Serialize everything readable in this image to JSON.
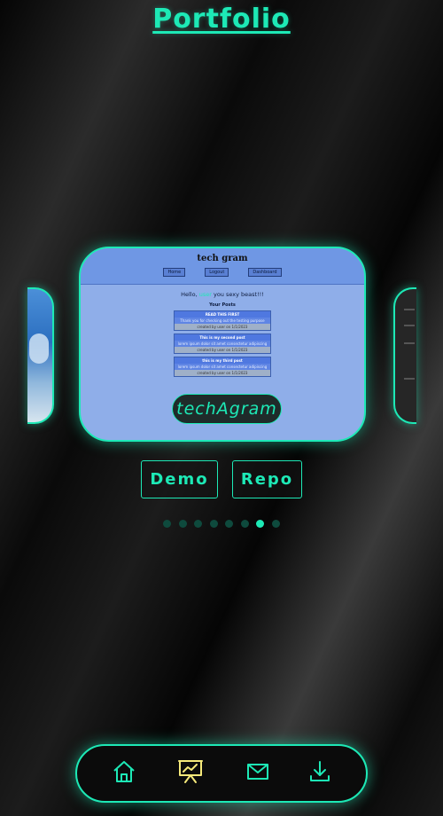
{
  "page": {
    "title": "Portfolio"
  },
  "carousel": {
    "current_project": {
      "label": "techAgram",
      "preview": {
        "brand": "tech gram",
        "nav": [
          "Home",
          "Logout",
          "Dashboard"
        ],
        "greeting_pre": "Hello,",
        "greeting_name": "user",
        "greeting_post": "you sexy beast!!!",
        "section_title": "Your Posts",
        "posts": [
          {
            "title": "READ THIS FIRST",
            "body": "Thank you for checking out the testing purpose",
            "meta": "created by user on 1/1/2023"
          },
          {
            "title": "This is my second post",
            "body": "lorem ipsum dolor sit amet consectetur adipiscing",
            "meta": "created by user on 1/1/2023"
          },
          {
            "title": "this is my third post",
            "body": "lorem ipsum dolor sit amet consectetur adipiscing",
            "meta": "created by user on 1/1/2023"
          }
        ]
      }
    },
    "total_slides": 8,
    "active_index": 6
  },
  "actions": {
    "demo_label": "Demo",
    "repo_label": "Repo"
  },
  "nav": {
    "items": [
      {
        "icon": "home-icon",
        "active": false
      },
      {
        "icon": "presentation-chart-icon",
        "active": true
      },
      {
        "icon": "mail-icon",
        "active": false
      },
      {
        "icon": "download-icon",
        "active": false
      }
    ]
  },
  "colors": {
    "accent": "#1de9b6",
    "active_nav": "#f5e97a",
    "card_bg": "#8faee9"
  }
}
